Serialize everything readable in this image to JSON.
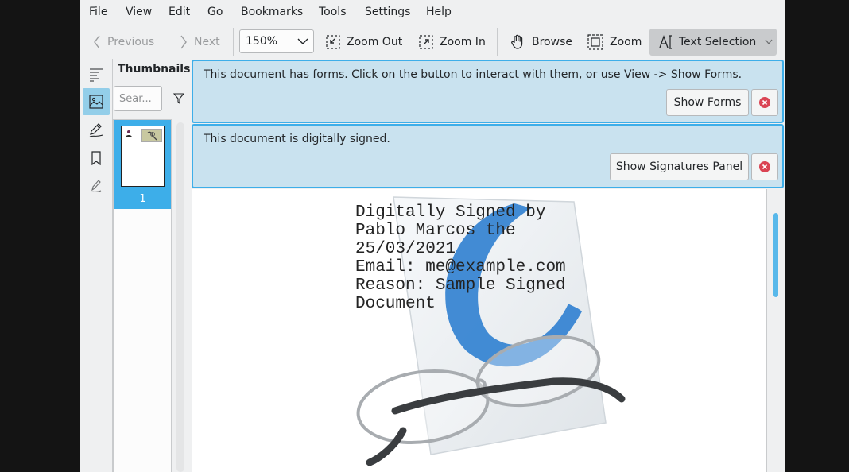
{
  "menubar": {
    "items": [
      "File",
      "View",
      "Edit",
      "Go",
      "Bookmarks",
      "Tools",
      "Settings",
      "Help"
    ]
  },
  "toolbar": {
    "previous_label": "Previous",
    "next_label": "Next",
    "zoom_value": "150%",
    "zoom_out_label": "Zoom Out",
    "zoom_in_label": "Zoom In",
    "browse_label": "Browse",
    "zoom_label": "Zoom",
    "text_selection_label": "Text Selection"
  },
  "sidebar": {
    "title": "Thumbnails",
    "search_placeholder": "Sear...",
    "page_number": "1"
  },
  "banners": {
    "forms": {
      "message": "This document has forms. Click on the button to interact with them, or use View -> Show Forms.",
      "button_label": "Show Forms"
    },
    "signed": {
      "message": "This document is digitally signed.",
      "button_label": "Show Signatures Panel"
    }
  },
  "document": {
    "signature_lines": [
      "Digitally Signed by",
      "Pablo Marcos the",
      "25/03/2021",
      "Email: me@example.com",
      "Reason: Sample Signed",
      "Document"
    ]
  },
  "colors": {
    "accent": "#3daee9",
    "banner_bg": "#c9e2ef",
    "close_red": "#da4453",
    "window_bg": "#eff0f1"
  }
}
